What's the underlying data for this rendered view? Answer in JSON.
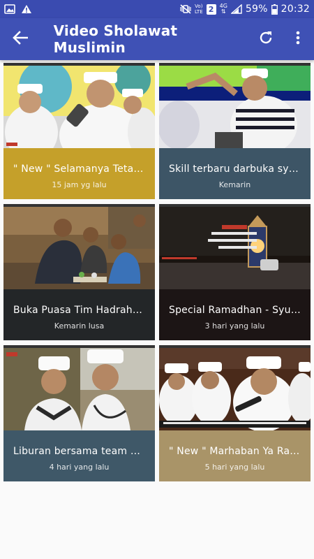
{
  "status_bar": {
    "network_label_top": "Vo)",
    "network_label_bottom": "LTE",
    "sim_slot": "2",
    "data_type": "4G",
    "battery_percent": "59%",
    "time": "20:32"
  },
  "app_bar": {
    "title": "Video Sholawat Muslimin",
    "back_icon": "arrow-back-icon",
    "refresh_icon": "refresh-icon",
    "menu_icon": "more-vert-icon"
  },
  "videos": [
    {
      "title": "\" New \" Selamanya Tetap ...",
      "time": "15 jam yg lalu",
      "caption_color": "#c5a02a"
    },
    {
      "title": "Skill terbaru darbuka syu...",
      "time": "Kemarin",
      "caption_color": "#3d5566"
    },
    {
      "title": "Buka Puasa Tim Hadrah S...",
      "time": "Kemarin lusa",
      "caption_color": "#232628"
    },
    {
      "title": "Special Ramadhan - Syub...",
      "time": "3 hari yang lalu",
      "caption_color": "#1c1515"
    },
    {
      "title": "Liburan bersama team ha...",
      "time": "4 hari yang lalu",
      "caption_color": "#3f5868"
    },
    {
      "title": "\" New \" Marhaban Ya Ram...",
      "time": "5 hari yang lalu",
      "caption_color": "#a99468"
    }
  ]
}
